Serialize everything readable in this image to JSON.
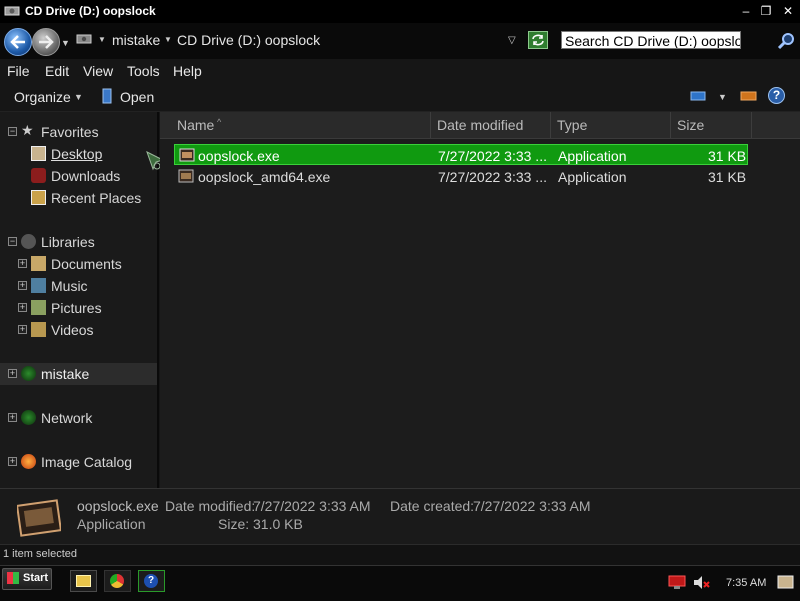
{
  "window": {
    "title": "CD Drive (D:) oopslock",
    "controls": {
      "minimize": "–",
      "maximize": "❐",
      "close": "✕"
    }
  },
  "address": {
    "crumbs": [
      "mistake",
      "CD Drive (D:) oopslock"
    ],
    "search_placeholder": "Search CD Drive (D:) oopslock"
  },
  "menu": [
    "File",
    "Edit",
    "View",
    "Tools",
    "Help"
  ],
  "toolbar": {
    "organize": "Organize",
    "open": "Open",
    "help": "?"
  },
  "nav": {
    "favorites": {
      "label": "Favorites",
      "items": [
        "Desktop",
        "Downloads",
        "Recent Places"
      ]
    },
    "libraries": {
      "label": "Libraries",
      "items": [
        "Documents",
        "Music",
        "Pictures",
        "Videos"
      ]
    },
    "mistake": "mistake",
    "network": "Network",
    "image_catalog": "Image Catalog"
  },
  "columns": {
    "name": "Name",
    "date": "Date modified",
    "type": "Type",
    "size": "Size"
  },
  "files": [
    {
      "name": "oopslock.exe",
      "date": "7/27/2022 3:33 ...",
      "type": "Application",
      "size": "31 KB",
      "selected": true
    },
    {
      "name": "oopslock_amd64.exe",
      "date": "7/27/2022 3:33 ...",
      "type": "Application",
      "size": "31 KB",
      "selected": false
    }
  ],
  "details": {
    "name": "oopslock.exe",
    "type": "Application",
    "modified_label": "Date modified:",
    "modified": "7/27/2022 3:33 AM",
    "created_label": "Date created:",
    "created": "7/27/2022 3:33 AM",
    "size_label": "Size:",
    "size": "31.0 KB"
  },
  "status": "1 item selected",
  "taskbar": {
    "start": "Start",
    "clock": "7:35 AM"
  },
  "colors": {
    "selection": "#109a10",
    "background": "#161616",
    "accent": "#2a78d8"
  }
}
